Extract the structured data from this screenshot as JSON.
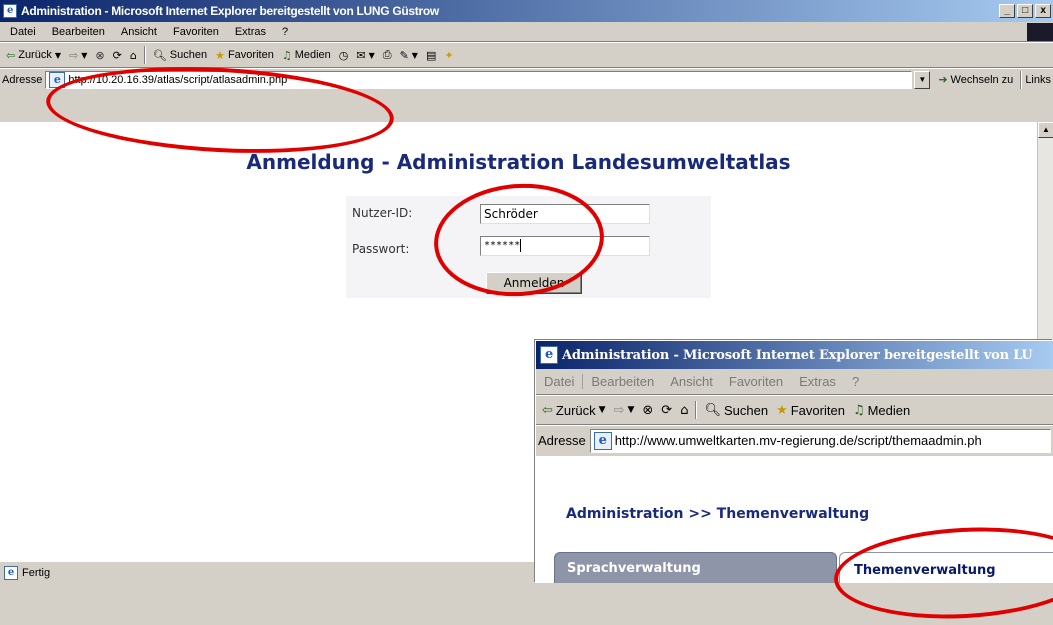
{
  "back_window": {
    "title": "Administration - Microsoft Internet Explorer bereitgestellt von LUNG Güstrow",
    "menu": [
      "Datei",
      "Bearbeiten",
      "Ansicht",
      "Favoriten",
      "Extras",
      "?"
    ],
    "toolbar": {
      "back": "Zurück",
      "search": "Suchen",
      "favorites": "Favoriten",
      "media": "Medien"
    },
    "address_label": "Adresse",
    "address": "http://10.20.16.39/atlas/script/atlasadmin.php",
    "go_label": "Wechseln zu",
    "links_label": "Links",
    "heading": "Anmeldung - Administration Landesumweltatlas",
    "form": {
      "user_label": "Nutzer-ID:",
      "user_value": "Schröder",
      "password_label": "Passwort:",
      "password_value": "******",
      "submit_label": "Anmelden"
    },
    "status": "Fertig"
  },
  "front_window": {
    "title": "Administration - Microsoft Internet Explorer bereitgestellt von LU",
    "menu": [
      "Datei",
      "Bearbeiten",
      "Ansicht",
      "Favoriten",
      "Extras",
      "?"
    ],
    "toolbar": {
      "back": "Zurück",
      "search": "Suchen",
      "favorites": "Favoriten",
      "media": "Medien"
    },
    "address_label": "Adresse",
    "address": "http://www.umweltkarten.mv-regierung.de/script/themaadmin.ph",
    "breadcrumb": "Administration >> Themenverwaltung",
    "tabs": [
      "Sprachverwaltung",
      "Themenverwaltung"
    ]
  },
  "colors": {
    "annotation_ring": "#e00000",
    "heading": "#1a2a7a",
    "tab_inactive": "#8e95a8",
    "tab_active_text": "#0a1a6a"
  }
}
